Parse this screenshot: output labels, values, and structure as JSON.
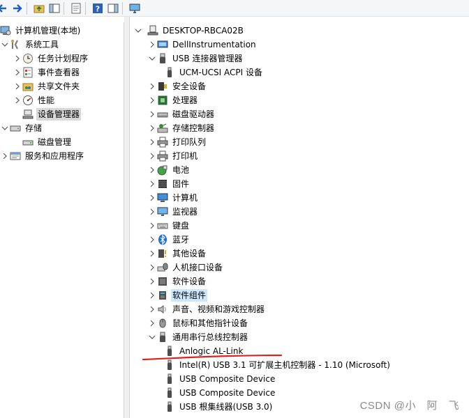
{
  "toolbar": {
    "buttons": [
      "back-icon",
      "forward-icon",
      "up-folder-icon",
      "show-hide-tree-icon",
      "properties-icon",
      "help-icon",
      "action-pane-icon",
      "monitor-icon"
    ]
  },
  "left_tree": {
    "root": "计算机管理(本地)",
    "system_tools": "系统工具",
    "task_scheduler": "任务计划程序",
    "event_viewer": "事件查看器",
    "shared_folders": "共享文件夹",
    "performance": "性能",
    "device_manager": "设备管理器",
    "storage": "存储",
    "disk_management": "磁盘管理",
    "services_apps": "服务和应用程序"
  },
  "device_tree": {
    "computer": "DESKTOP-RBCA02B",
    "items": [
      {
        "label": "DellInstrumentation",
        "icon": "dell-icon"
      },
      {
        "label": "USB 连接器管理器",
        "icon": "usb-connector-icon",
        "expanded": true
      },
      {
        "label": "UCM-UCSI ACPI 设备",
        "icon": "usb-plug-icon",
        "child": true
      },
      {
        "label": "安全设备",
        "icon": "security-device-icon"
      },
      {
        "label": "处理器",
        "icon": "processor-icon"
      },
      {
        "label": "磁盘驱动器",
        "icon": "disk-drive-icon"
      },
      {
        "label": "存储控制器",
        "icon": "storage-controller-icon"
      },
      {
        "label": "打印队列",
        "icon": "printer-icon"
      },
      {
        "label": "打印机",
        "icon": "printer-icon"
      },
      {
        "label": "电池",
        "icon": "battery-icon"
      },
      {
        "label": "固件",
        "icon": "firmware-icon"
      },
      {
        "label": "计算机",
        "icon": "computer-icon"
      },
      {
        "label": "监视器",
        "icon": "monitor-icon"
      },
      {
        "label": "键盘",
        "icon": "keyboard-icon"
      },
      {
        "label": "蓝牙",
        "icon": "bluetooth-icon"
      },
      {
        "label": "其他设备",
        "icon": "other-devices-icon"
      },
      {
        "label": "人机接口设备",
        "icon": "hid-icon"
      },
      {
        "label": "软件设备",
        "icon": "software-device-icon"
      },
      {
        "label": "软件组件",
        "icon": "software-component-icon",
        "selected": true
      },
      {
        "label": "声音、视频和游戏控制器",
        "icon": "speaker-icon"
      },
      {
        "label": "鼠标和其他指针设备",
        "icon": "mouse-icon"
      },
      {
        "label": "通用串行总线控制器",
        "icon": "usb-connector-icon",
        "expanded": true
      },
      {
        "label": "Anlogic AL-Link",
        "icon": "usb-plug-icon",
        "child": true
      },
      {
        "label": "Intel(R) USB 3.1 可扩展主机控制器 - 1.10 (Microsoft)",
        "icon": "usb-plug-icon",
        "child": true
      },
      {
        "label": "USB Composite Device",
        "icon": "usb-plug-icon",
        "child": true
      },
      {
        "label": "USB Composite Device",
        "icon": "usb-plug-icon",
        "child": true
      },
      {
        "label": "USB 根集线器(USB 3.0)",
        "icon": "usb-plug-icon",
        "child": true
      }
    ]
  },
  "annotation": {
    "color": "#e02020"
  },
  "watermark": "CSDN @小　阿　飞"
}
